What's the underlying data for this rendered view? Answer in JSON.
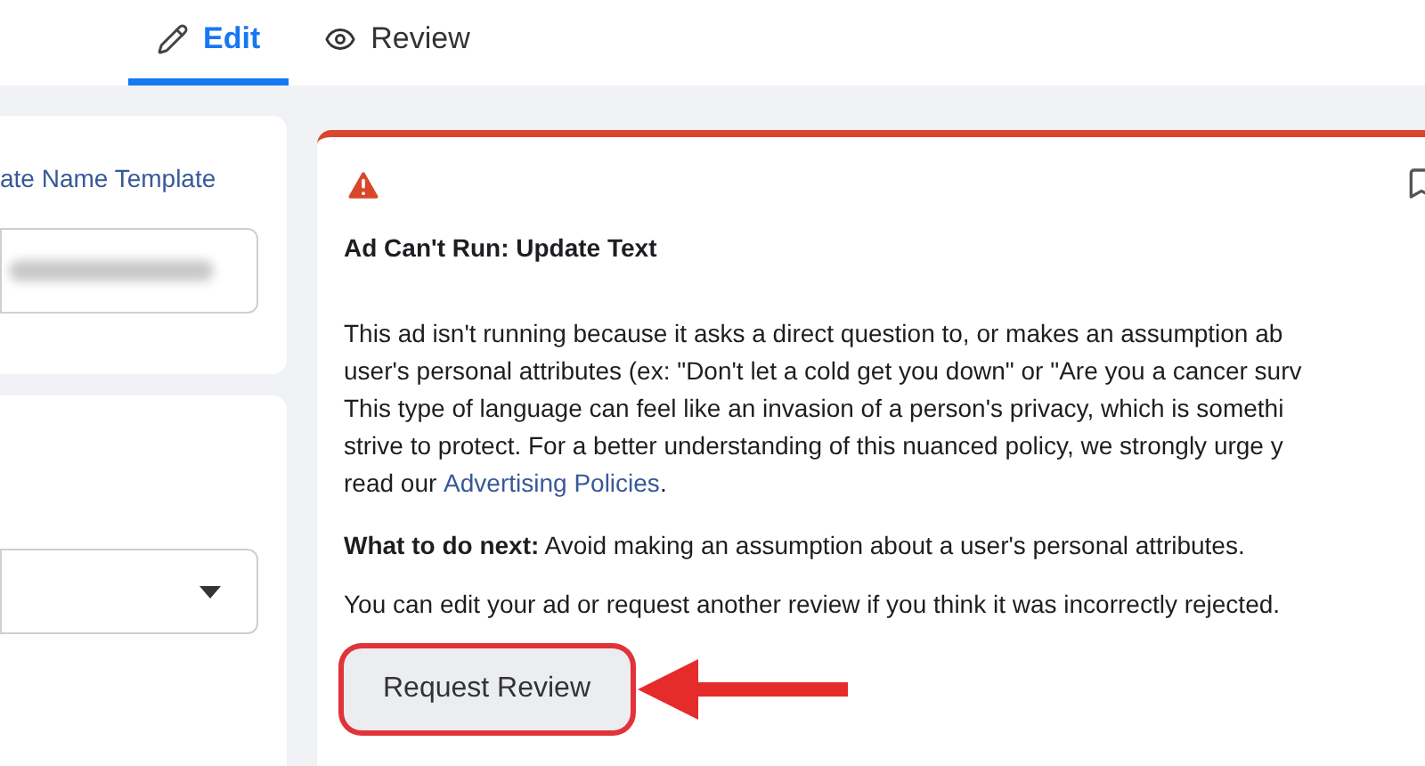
{
  "tabs": [
    {
      "label": "Edit",
      "kind": "pencil",
      "selected": true
    },
    {
      "label": "Review",
      "kind": "eye",
      "selected": false
    }
  ],
  "left_panel": {
    "link": "ate Name Template",
    "name_field": {
      "kind": "blurred"
    },
    "select": {
      "kind": "dropdown"
    }
  },
  "alert": {
    "title": "Ad Can't Run: Update Text",
    "body_lines": [
      "This ad isn't running because it asks a direct question to, or makes an assumption ab",
      "user's personal attributes (ex: \"Don't let a cold get you down\" or \"Are you a cancer surv",
      "This type of language can feel like an invasion of a person's privacy, which is somethi",
      "strive to protect. For a better understanding of this nuanced policy, we strongly urge y"
    ],
    "last_line_prefix": "read our ",
    "policy_link": "Advertising Policies",
    "last_line_suffix": ".",
    "next_steps": "**What to do next:** Avoid making an assumption about a user's personal attributes.",
    "note": "You can edit your ad or request another review if you think it was incorrectly rejected.",
    "button": "Request Review",
    "highlighted": true
  }
}
